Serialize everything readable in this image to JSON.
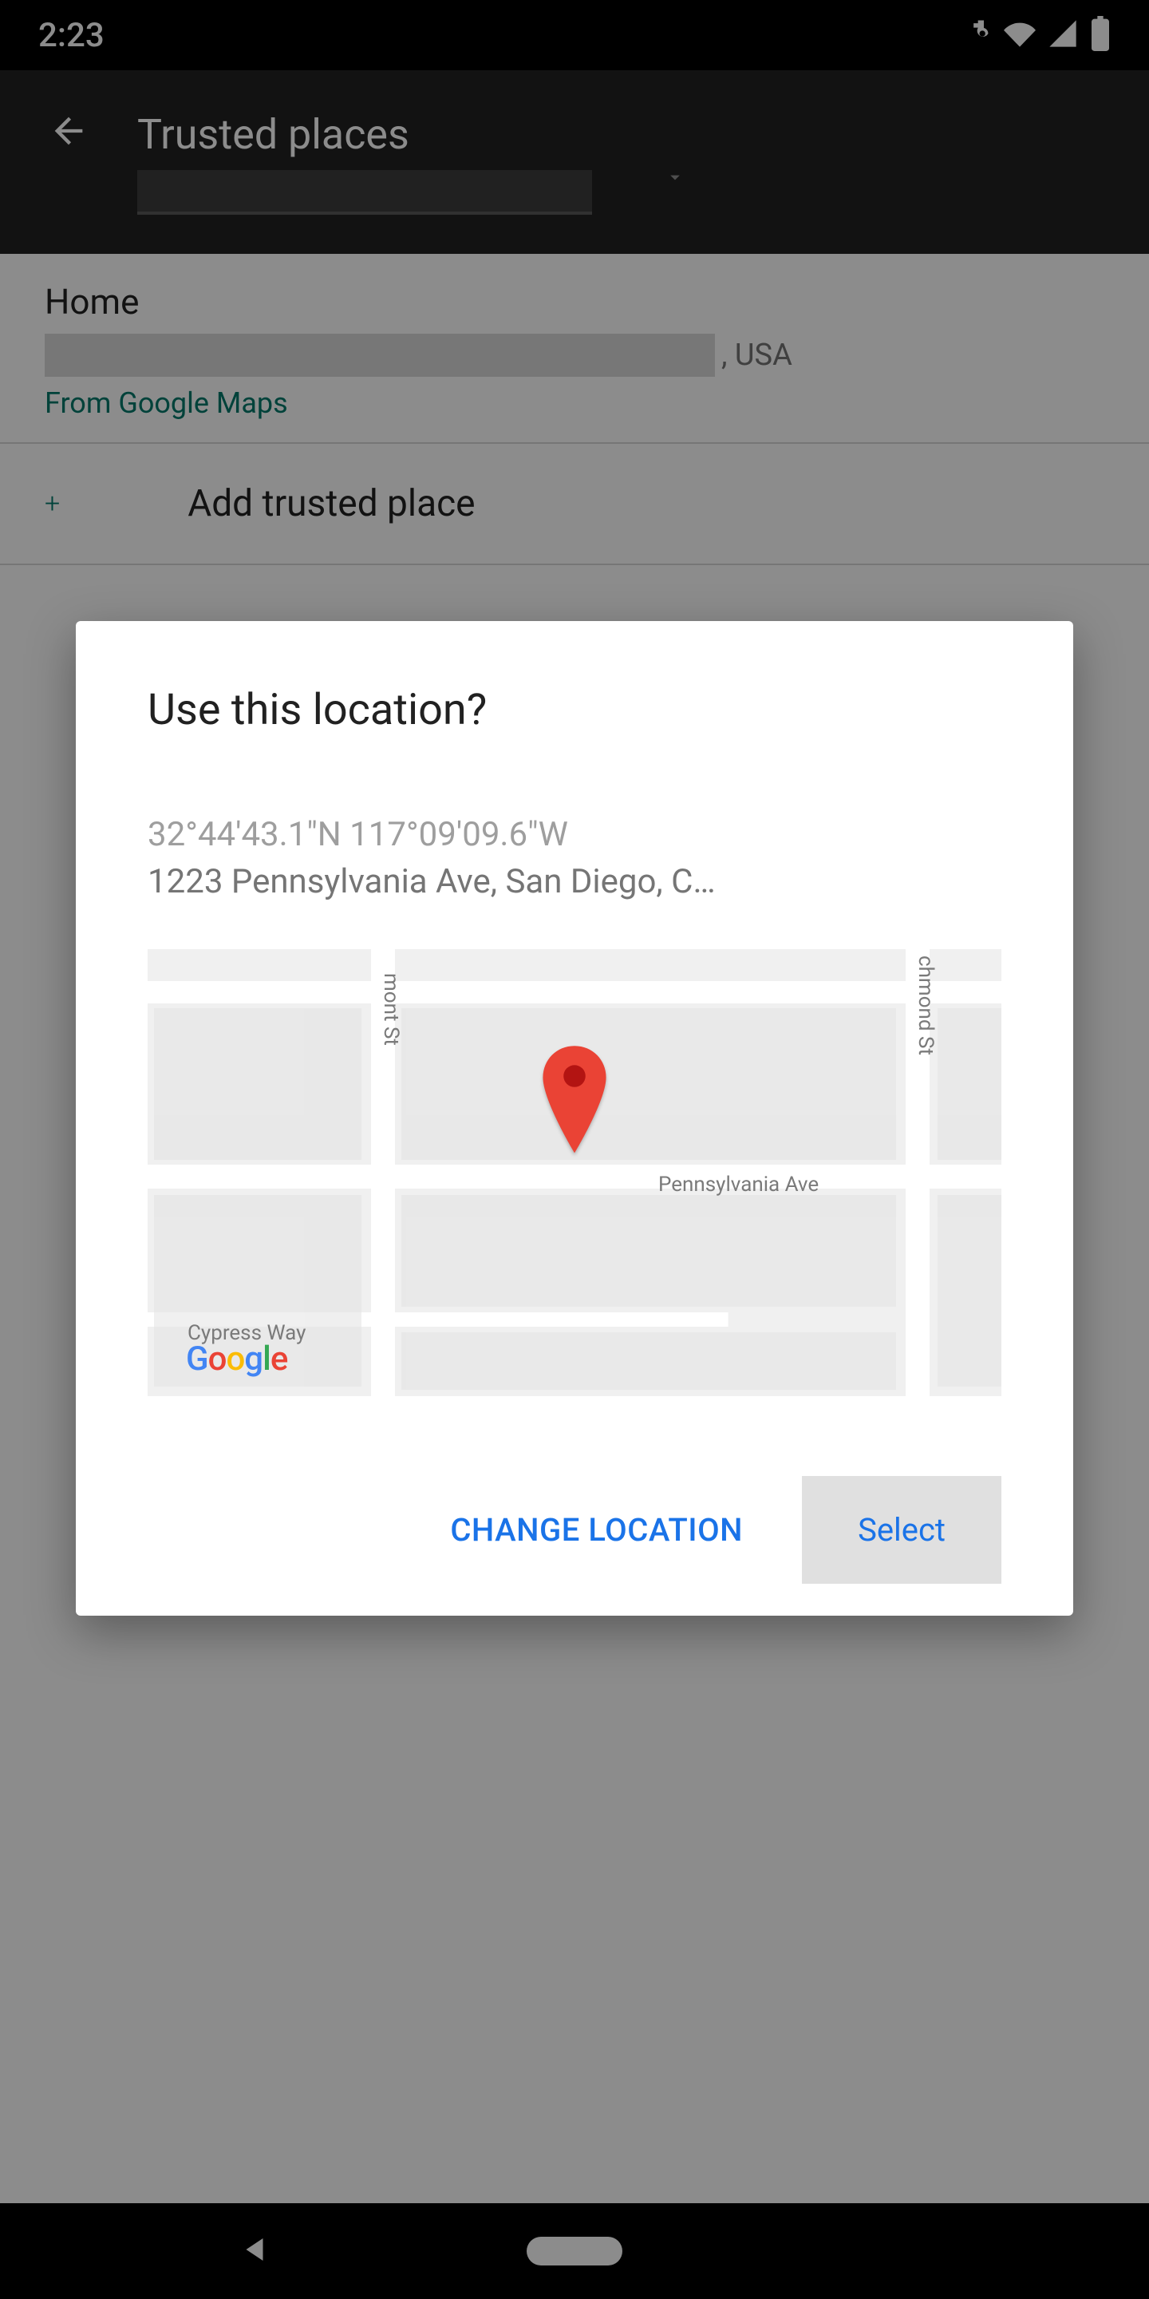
{
  "status": {
    "time": "2:23"
  },
  "appbar": {
    "title": "Trusted places"
  },
  "place": {
    "title": "Home",
    "addr_suffix": ", USA",
    "source": "From Google Maps"
  },
  "add_row": {
    "label": "Add trusted place"
  },
  "dialog": {
    "title": "Use this location?",
    "coords": "32°44'43.1\"N 117°09'09.6\"W",
    "address": "1223 Pennsylvania Ave, San Diego, C…",
    "map": {
      "label_penn": "Pennsylvania Ave",
      "label_cypress": "Cypress Way",
      "label_mont": "mont St",
      "label_rich": "chmond St"
    },
    "change_btn": "CHANGE LOCATION",
    "select_btn": "Select"
  }
}
